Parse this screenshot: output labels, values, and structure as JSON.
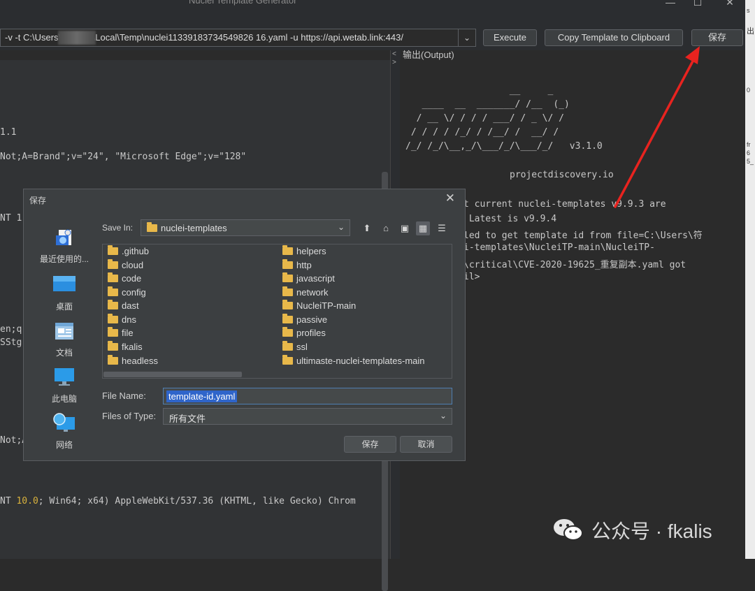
{
  "window": {
    "title": "Nuclei Template Generator",
    "min": "—",
    "max": "☐",
    "close": "✕"
  },
  "toolbar": {
    "command": "-v -t C:\\Users\\         ppData\\Local\\Temp\\nuclei11339183734549826 16.yaml -u https://api.wetab.link:443/",
    "execute": "Execute",
    "copy": "Copy Template to Clipboard",
    "save": "保存"
  },
  "editor": {
    "lines": [
      "1.1",
      "Not;A=Brand\";v=\"24\", \"Microsoft Edge\";v=\"128\"",
      "NT 1",
      "en;q",
      "SStg",
      "Not;A",
      "NT ",
      "10.0",
      "; Win64; x64) AppleWebKit/537.36 (KHTML, like Gecko) Chrom"
    ]
  },
  "output": {
    "label": "输出(Output)",
    "ascii": [
      "                   __     _",
      "   ____  __  _______/ /__  (_)",
      "  / __ \\/ / / / ___/ / _ \\/ /",
      " / / / / /_/ / /__/ /  __/ /",
      "/_/ /_/\\__,_/\\___/_/\\___/_/   v3.1.0"
    ],
    "brand": "projectdiscovery.io",
    "log": [
      "t current nuclei-templates v9.9.3 are",
      " Latest is v9.9.4",
      "led to get template id from file=C:\\Users\\符",
      "i-templates\\NucleiTP-main\\NucleiTP-",
      "\\critical\\CVE-2020-19625_重复副本.yaml got",
      "il>"
    ]
  },
  "dialog": {
    "title": "保存",
    "places": [
      {
        "label": "最近使用的...",
        "icon": "recent-icon"
      },
      {
        "label": "桌面",
        "icon": "desktop-icon"
      },
      {
        "label": "文档",
        "icon": "documents-icon"
      },
      {
        "label": "此电脑",
        "icon": "computer-icon"
      },
      {
        "label": "网络",
        "icon": "network-icon"
      }
    ],
    "save_in_label": "Save In:",
    "save_in_value": "nuclei-templates",
    "folders_left": [
      ".github",
      "cloud",
      "code",
      "config",
      "dast",
      "dns",
      "file",
      "fkalis",
      "headless"
    ],
    "folders_right": [
      "helpers",
      "http",
      "javascript",
      "network",
      "NucleiTP-main",
      "passive",
      "profiles",
      "ssl",
      "ultimaste-nuclei-templates-main"
    ],
    "file_name_label": "File Name:",
    "file_name_value": "template-id.yaml",
    "file_type_label": "Files of Type:",
    "file_type_value": "所有文件",
    "ok": "保存",
    "cancel": "取消"
  },
  "right_strip": {
    "top": "s",
    "mid": "出",
    "n1": "0",
    "n2": "fr",
    "n3": "6",
    "n4": "5_"
  },
  "watermark": {
    "text": "公众号 · fkalis"
  },
  "colors": {
    "accent": "#2f65ca",
    "folder": "#e8b84a",
    "arrow": "#e8231f"
  }
}
